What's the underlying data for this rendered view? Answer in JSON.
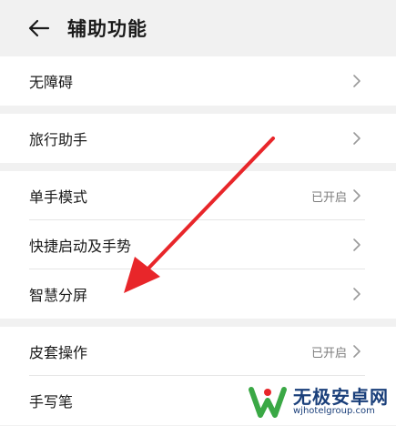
{
  "header": {
    "title": "辅助功能"
  },
  "groups": [
    [
      {
        "label": "无障碍",
        "status": ""
      }
    ],
    [
      {
        "label": "旅行助手",
        "status": ""
      }
    ],
    [
      {
        "label": "单手模式",
        "status": "已开启"
      },
      {
        "label": "快捷启动及手势",
        "status": ""
      },
      {
        "label": "智慧分屏",
        "status": ""
      }
    ],
    [
      {
        "label": "皮套操作",
        "status": "已开启"
      },
      {
        "label": "手写笔",
        "status": ""
      }
    ]
  ],
  "watermark": {
    "name": "无极安卓网",
    "url": "wjhotelgroup.com"
  },
  "colors": {
    "annotation_arrow": "#e8262a",
    "watermark_text": "#1a3f7a"
  },
  "icons": {
    "back": "back-arrow-icon",
    "chevron": "chevron-right-icon"
  }
}
